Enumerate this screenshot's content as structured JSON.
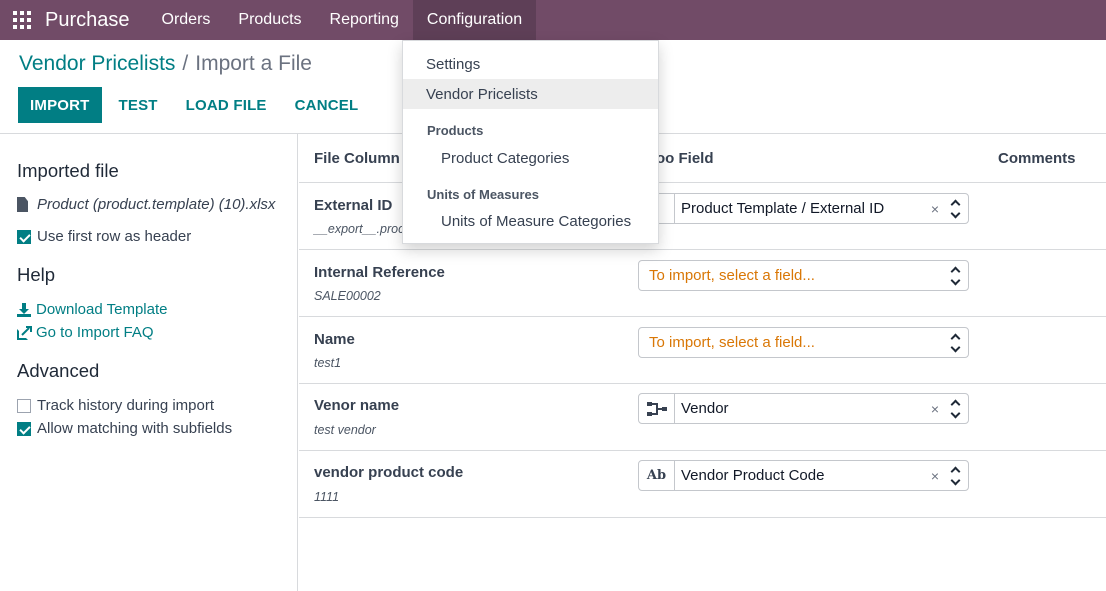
{
  "navbar": {
    "app_icon": "apps-grid-icon",
    "brand": "Purchase",
    "items": [
      {
        "label": "Orders"
      },
      {
        "label": "Products"
      },
      {
        "label": "Reporting"
      },
      {
        "label": "Configuration"
      }
    ]
  },
  "breadcrumb": {
    "parent": "Vendor Pricelists",
    "separator": "/",
    "current": "Import a File"
  },
  "actions": {
    "import": "IMPORT",
    "test": "TEST",
    "load_file": "LOAD FILE",
    "cancel": "CANCEL"
  },
  "sidebar": {
    "imported_file_heading": "Imported file",
    "file_name": "Product (product.template) (10).xlsx",
    "use_header_label": "Use first row as header",
    "use_header_checked": true,
    "help_heading": "Help",
    "download_template": "Download Template",
    "import_faq": "Go to Import FAQ",
    "advanced_heading": "Advanced",
    "track_history_label": "Track history during import",
    "track_history_checked": false,
    "allow_matching_label": "Allow matching with subfields",
    "allow_matching_checked": true
  },
  "table": {
    "headers": {
      "file_column": "File Column",
      "odoo_field": "oo Field",
      "comments": "Comments"
    },
    "rows": [
      {
        "name": "External ID",
        "sample": "__export__.proc",
        "field": "Product Template / External ID",
        "field_icon": "fingerprint-icon",
        "placeholder": false
      },
      {
        "name": "Internal Reference",
        "sample": "SALE00002",
        "field": "To import, select a field...",
        "field_icon": "",
        "placeholder": true
      },
      {
        "name": "Name",
        "sample": "test1",
        "field": "To import, select a field...",
        "field_icon": "",
        "placeholder": true
      },
      {
        "name": "Venor name",
        "sample": "test vendor",
        "field": "Vendor",
        "field_icon": "relation-icon",
        "placeholder": false
      },
      {
        "name": "vendor product code",
        "sample": "1111",
        "field": "Vendor Product Code",
        "field_icon": "text-field-icon",
        "field_icon_text": "Ab",
        "placeholder": false
      }
    ],
    "clear_glyph": "×"
  },
  "dropdown": {
    "items": {
      "settings": "Settings",
      "vendor_pricelists": "Vendor Pricelists"
    },
    "sections": {
      "products": "Products",
      "units": "Units of Measures"
    },
    "sub_items": {
      "product_categories": "Product Categories",
      "uom_categories": "Units of Measure Categories"
    }
  }
}
